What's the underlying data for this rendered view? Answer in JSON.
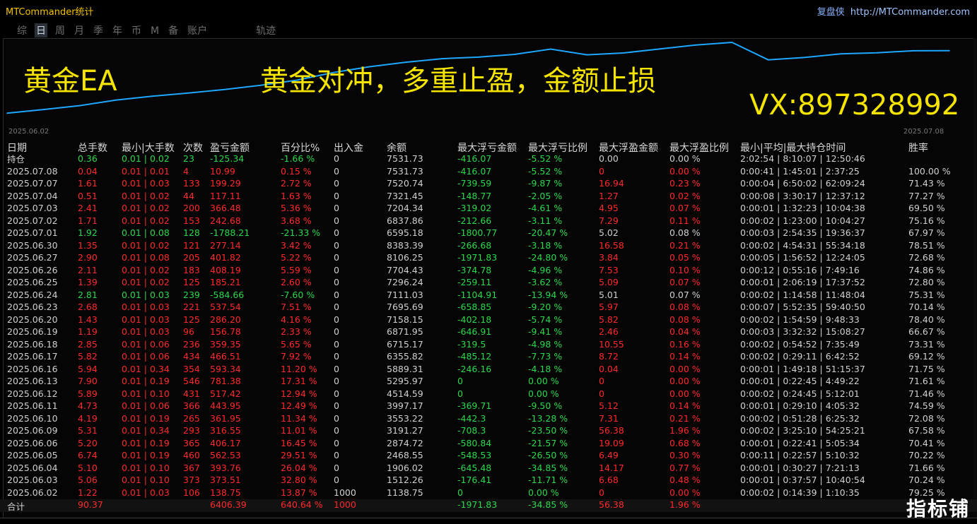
{
  "app": {
    "title": "MTCommander统计",
    "brand": "复盘侠",
    "url": "http://MTCommander.com"
  },
  "tabs": [
    {
      "label": "综",
      "active": false
    },
    {
      "label": "日",
      "active": true
    },
    {
      "label": "周",
      "active": false
    },
    {
      "label": "月",
      "active": false
    },
    {
      "label": "季",
      "active": false
    },
    {
      "label": "年",
      "active": false
    },
    {
      "label": "币",
      "active": false
    },
    {
      "label": "M",
      "active": false
    },
    {
      "label": "备",
      "active": false
    },
    {
      "label": "账户",
      "active": false
    },
    {
      "label": "轨迹",
      "active": false
    }
  ],
  "overlay": {
    "line1": "黄金EA",
    "line2": "黄金对冲，多重止盈，金额止损",
    "line3": "VX:897328992"
  },
  "chart_data": {
    "type": "line",
    "x_start": "2025.06.02",
    "x_end": "2025.07.08",
    "series_color": "#1ea7ff",
    "values": [
      1138.75,
      1512.26,
      1906.02,
      2468.55,
      2874.72,
      3191.27,
      3553.22,
      3997.17,
      4514.59,
      5295.97,
      5889.31,
      6355.82,
      6715.17,
      6871.95,
      7158.15,
      7695.69,
      7111.03,
      7296.24,
      7704.43,
      8106.25,
      8383.39,
      6595.18,
      6837.86,
      7204.34,
      7321.45,
      7520.74,
      7531.73
    ]
  },
  "headers": [
    "日期",
    "总手数",
    "最小|大手数",
    "次数",
    "盈亏金额",
    "百分比%",
    "出入金",
    "余额",
    "最大浮亏金额",
    "最大浮亏比例",
    "最大浮盈金额",
    "最大浮盈比例",
    "最小|平均|最大持仓时间",
    "胜率"
  ],
  "rows": [
    {
      "date": "持仓",
      "lots": "0.36",
      "minmax": "0.01 | 0.02",
      "count": "23",
      "pl": "-125.34",
      "pct": "-1.66 %",
      "io": "0",
      "bal": "7531.73",
      "mdd": "-416.07",
      "mddp": "-5.52 %",
      "mfe": "0.00",
      "mfep": "0.00 %",
      "time": "2:02:54 | 8:10:07 | 12:50:46",
      "win": "",
      "c": "g"
    },
    {
      "date": "2025.07.08",
      "lots": "0.04",
      "minmax": "0.01 | 0.01",
      "count": "4",
      "pl": "10.99",
      "pct": "0.15 %",
      "io": "0",
      "bal": "7531.73",
      "mdd": "-416.07",
      "mddp": "-5.52 %",
      "mfe": "0",
      "mfep": "0.00 %",
      "time": "0:00:41 | 1:45:01 | 2:37:25",
      "win": "100.00 %",
      "c": "r"
    },
    {
      "date": "2025.07.07",
      "lots": "1.61",
      "minmax": "0.01 | 0.03",
      "count": "133",
      "pl": "199.29",
      "pct": "2.72 %",
      "io": "0",
      "bal": "7520.74",
      "mdd": "-739.59",
      "mddp": "-9.87 %",
      "mfe": "16.94",
      "mfep": "0.23 %",
      "time": "0:00:04 | 6:50:02 | 62:09:24",
      "win": "71.43 %",
      "c": "r"
    },
    {
      "date": "2025.07.04",
      "lots": "0.51",
      "minmax": "0.01 | 0.02",
      "count": "44",
      "pl": "117.11",
      "pct": "1.63 %",
      "io": "0",
      "bal": "7321.45",
      "mdd": "-148.77",
      "mddp": "-2.05 %",
      "mfe": "1.27",
      "mfep": "0.02 %",
      "time": "0:00:08 | 3:30:17 | 12:37:12",
      "win": "77.27 %",
      "c": "r"
    },
    {
      "date": "2025.07.03",
      "lots": "2.41",
      "minmax": "0.01 | 0.02",
      "count": "200",
      "pl": "366.48",
      "pct": "5.36 %",
      "io": "0",
      "bal": "7204.34",
      "mdd": "-319.02",
      "mddp": "-4.61 %",
      "mfe": "4.95",
      "mfep": "0.07 %",
      "time": "0:00:01 | 1:32:23 | 10:04:38",
      "win": "69.50 %",
      "c": "r"
    },
    {
      "date": "2025.07.02",
      "lots": "1.71",
      "minmax": "0.01 | 0.02",
      "count": "153",
      "pl": "242.68",
      "pct": "3.68 %",
      "io": "0",
      "bal": "6837.86",
      "mdd": "-212.66",
      "mddp": "-3.11 %",
      "mfe": "7.29",
      "mfep": "0.11 %",
      "time": "0:00:02 | 1:23:00 | 10:04:27",
      "win": "75.16 %",
      "c": "r"
    },
    {
      "date": "2025.07.01",
      "lots": "1.92",
      "minmax": "0.01 | 0.08",
      "count": "128",
      "pl": "-1788.21",
      "pct": "-21.33 %",
      "io": "0",
      "bal": "6595.18",
      "mdd": "-1800.77",
      "mddp": "-20.47 %",
      "mfe": "5.02",
      "mfep": "0.08 %",
      "time": "0:00:03 | 2:54:35 | 19:36:37",
      "win": "67.97 %",
      "c": "g"
    },
    {
      "date": "2025.06.30",
      "lots": "1.35",
      "minmax": "0.01 | 0.02",
      "count": "121",
      "pl": "277.14",
      "pct": "3.42 %",
      "io": "0",
      "bal": "8383.39",
      "mdd": "-266.68",
      "mddp": "-3.18 %",
      "mfe": "16.58",
      "mfep": "0.21 %",
      "time": "0:00:02 | 4:54:31 | 55:34:18",
      "win": "78.51 %",
      "c": "r"
    },
    {
      "date": "2025.06.27",
      "lots": "2.90",
      "minmax": "0.01 | 0.08",
      "count": "205",
      "pl": "401.82",
      "pct": "5.22 %",
      "io": "0",
      "bal": "8106.25",
      "mdd": "-1971.83",
      "mddp": "-24.80 %",
      "mfe": "3.84",
      "mfep": "0.05 %",
      "time": "0:00:05 | 1:56:52 | 12:24:05",
      "win": "72.68 %",
      "c": "r"
    },
    {
      "date": "2025.06.26",
      "lots": "2.11",
      "minmax": "0.01 | 0.02",
      "count": "183",
      "pl": "408.19",
      "pct": "5.59 %",
      "io": "0",
      "bal": "7704.43",
      "mdd": "-374.78",
      "mddp": "-4.96 %",
      "mfe": "7.53",
      "mfep": "0.10 %",
      "time": "0:00:12 | 0:55:16 | 7:49:16",
      "win": "74.86 %",
      "c": "r"
    },
    {
      "date": "2025.06.25",
      "lots": "1.39",
      "minmax": "0.01 | 0.02",
      "count": "125",
      "pl": "185.21",
      "pct": "2.60 %",
      "io": "0",
      "bal": "7296.24",
      "mdd": "-259.11",
      "mddp": "-3.62 %",
      "mfe": "5.09",
      "mfep": "0.07 %",
      "time": "0:00:01 | 2:06:19 | 17:37:52",
      "win": "72.80 %",
      "c": "r"
    },
    {
      "date": "2025.06.24",
      "lots": "2.81",
      "minmax": "0.01 | 0.03",
      "count": "239",
      "pl": "-584.66",
      "pct": "-7.60 %",
      "io": "0",
      "bal": "7111.03",
      "mdd": "-1104.91",
      "mddp": "-13.94 %",
      "mfe": "5.01",
      "mfep": "0.07 %",
      "time": "0:00:02 | 1:14:58 | 11:48:04",
      "win": "75.31 %",
      "c": "g"
    },
    {
      "date": "2025.06.23",
      "lots": "2.68",
      "minmax": "0.01 | 0.03",
      "count": "221",
      "pl": "537.54",
      "pct": "7.51 %",
      "io": "0",
      "bal": "7695.69",
      "mdd": "-658.85",
      "mddp": "-9.20 %",
      "mfe": "5.97",
      "mfep": "0.08 %",
      "time": "0:00:07 | 5:52:35 | 59:40:50",
      "win": "70.14 %",
      "c": "r"
    },
    {
      "date": "2025.06.20",
      "lots": "1.43",
      "minmax": "0.01 | 0.03",
      "count": "125",
      "pl": "286.20",
      "pct": "4.16 %",
      "io": "0",
      "bal": "7158.15",
      "mdd": "-402.18",
      "mddp": "-5.74 %",
      "mfe": "5.82",
      "mfep": "0.08 %",
      "time": "0:00:02 | 1:54:59 | 9:48:33",
      "win": "78.40 %",
      "c": "r"
    },
    {
      "date": "2025.06.19",
      "lots": "1.19",
      "minmax": "0.01 | 0.03",
      "count": "96",
      "pl": "156.78",
      "pct": "2.33 %",
      "io": "0",
      "bal": "6871.95",
      "mdd": "-646.91",
      "mddp": "-9.41 %",
      "mfe": "2.46",
      "mfep": "0.04 %",
      "time": "0:00:03 | 3:32:32 | 15:08:27",
      "win": "66.67 %",
      "c": "r"
    },
    {
      "date": "2025.06.18",
      "lots": "2.85",
      "minmax": "0.01 | 0.06",
      "count": "236",
      "pl": "359.35",
      "pct": "5.65 %",
      "io": "0",
      "bal": "6715.17",
      "mdd": "-319.5",
      "mddp": "-4.98 %",
      "mfe": "10.55",
      "mfep": "0.16 %",
      "time": "0:00:02 | 0:54:52 | 7:35:49",
      "win": "73.31 %",
      "c": "r"
    },
    {
      "date": "2025.06.17",
      "lots": "5.82",
      "minmax": "0.01 | 0.06",
      "count": "434",
      "pl": "466.51",
      "pct": "7.92 %",
      "io": "0",
      "bal": "6355.82",
      "mdd": "-485.12",
      "mddp": "-7.73 %",
      "mfe": "8.72",
      "mfep": "0.14 %",
      "time": "0:00:02 | 0:29:11 | 6:42:52",
      "win": "69.12 %",
      "c": "r"
    },
    {
      "date": "2025.06.16",
      "lots": "5.94",
      "minmax": "0.01 | 0.34",
      "count": "354",
      "pl": "593.34",
      "pct": "11.20 %",
      "io": "0",
      "bal": "5889.31",
      "mdd": "-246.16",
      "mddp": "-4.18 %",
      "mfe": "0.04",
      "mfep": "0.00 %",
      "time": "0:00:01 | 1:49:18 | 51:15:37",
      "win": "71.75 %",
      "c": "r"
    },
    {
      "date": "2025.06.13",
      "lots": "7.90",
      "minmax": "0.01 | 0.19",
      "count": "546",
      "pl": "781.38",
      "pct": "17.31 %",
      "io": "0",
      "bal": "5295.97",
      "mdd": "0",
      "mddp": "0.00 %",
      "mfe": "0",
      "mfep": "0.00 %",
      "time": "0:00:01 | 0:22:45 | 4:49:22",
      "win": "71.61 %",
      "c": "r"
    },
    {
      "date": "2025.06.12",
      "lots": "5.89",
      "minmax": "0.01 | 0.10",
      "count": "431",
      "pl": "517.42",
      "pct": "12.94 %",
      "io": "0",
      "bal": "4514.59",
      "mdd": "0",
      "mddp": "0.00 %",
      "mfe": "0",
      "mfep": "0.00 %",
      "time": "0:00:02 | 0:24:45 | 5:12:01",
      "win": "71.46 %",
      "c": "r"
    },
    {
      "date": "2025.06.11",
      "lots": "4.73",
      "minmax": "0.01 | 0.06",
      "count": "366",
      "pl": "443.95",
      "pct": "12.49 %",
      "io": "0",
      "bal": "3997.17",
      "mdd": "-369.71",
      "mddp": "-9.50 %",
      "mfe": "5.12",
      "mfep": "0.14 %",
      "time": "0:00:01 | 0:29:10 | 4:05:32",
      "win": "74.59 %",
      "c": "r"
    },
    {
      "date": "2025.06.10",
      "lots": "4.19",
      "minmax": "0.01 | 0.19",
      "count": "265",
      "pl": "361.95",
      "pct": "11.34 %",
      "io": "0",
      "bal": "3553.22",
      "mdd": "-442.3",
      "mddp": "-13.28 %",
      "mfe": "7.31",
      "mfep": "0.21 %",
      "time": "0:00:02 | 0:51:28 | 6:25:32",
      "win": "72.08 %",
      "c": "r"
    },
    {
      "date": "2025.06.09",
      "lots": "5.31",
      "minmax": "0.01 | 0.34",
      "count": "293",
      "pl": "316.55",
      "pct": "11.01 %",
      "io": "0",
      "bal": "3191.27",
      "mdd": "-708.3",
      "mddp": "-23.50 %",
      "mfe": "56.38",
      "mfep": "1.96 %",
      "time": "0:00:02 | 3:25:10 | 54:25:21",
      "win": "67.58 %",
      "c": "r"
    },
    {
      "date": "2025.06.06",
      "lots": "5.20",
      "minmax": "0.01 | 0.19",
      "count": "365",
      "pl": "406.17",
      "pct": "16.45 %",
      "io": "0",
      "bal": "2874.72",
      "mdd": "-580.84",
      "mddp": "-21.57 %",
      "mfe": "19.09",
      "mfep": "0.68 %",
      "time": "0:00:01 | 0:22:41 | 5:05:34",
      "win": "70.41 %",
      "c": "r"
    },
    {
      "date": "2025.06.05",
      "lots": "6.74",
      "minmax": "0.01 | 0.19",
      "count": "460",
      "pl": "562.53",
      "pct": "29.51 %",
      "io": "0",
      "bal": "2468.55",
      "mdd": "-548.53",
      "mddp": "-26.50 %",
      "mfe": "6.49",
      "mfep": "0.30 %",
      "time": "0:00:11 | 0:22:57 | 5:10:32",
      "win": "70.22 %",
      "c": "r"
    },
    {
      "date": "2025.06.04",
      "lots": "5.10",
      "minmax": "0.01 | 0.10",
      "count": "367",
      "pl": "393.76",
      "pct": "26.04 %",
      "io": "0",
      "bal": "1906.02",
      "mdd": "-645.48",
      "mddp": "-34.85 %",
      "mfe": "14.17",
      "mfep": "0.77 %",
      "time": "0:00:01 | 0:30:27 | 7:21:13",
      "win": "71.66 %",
      "c": "r"
    },
    {
      "date": "2025.06.03",
      "lots": "5.06",
      "minmax": "0.01 | 0.10",
      "count": "373",
      "pl": "373.51",
      "pct": "32.80 %",
      "io": "0",
      "bal": "1512.26",
      "mdd": "-176.41",
      "mddp": "-11.71 %",
      "mfe": "6.68",
      "mfep": "0.48 %",
      "time": "0:00:01 | 0:37:57 | 10:40:54",
      "win": "70.24 %",
      "c": "r"
    },
    {
      "date": "2025.06.02",
      "lots": "1.22",
      "minmax": "0.01 | 0.03",
      "count": "106",
      "pl": "138.75",
      "pct": "13.87 %",
      "io": "1000",
      "bal": "1138.75",
      "mdd": "0",
      "mddp": "0.00 %",
      "mfe": "0",
      "mfep": "0.00 %",
      "time": "0:00:02 | 0:14:39 | 1:10:35",
      "win": "79.25 %",
      "c": "r"
    }
  ],
  "total": {
    "label": "合计",
    "lots": "90.37",
    "pl": "6406.39",
    "pct": "640.64 %",
    "io": "1000",
    "mdd": "-1971.83",
    "mddp": "-34.85 %",
    "mfe": "56.38",
    "mfep": "1.96 %"
  },
  "logo": "指标铺"
}
